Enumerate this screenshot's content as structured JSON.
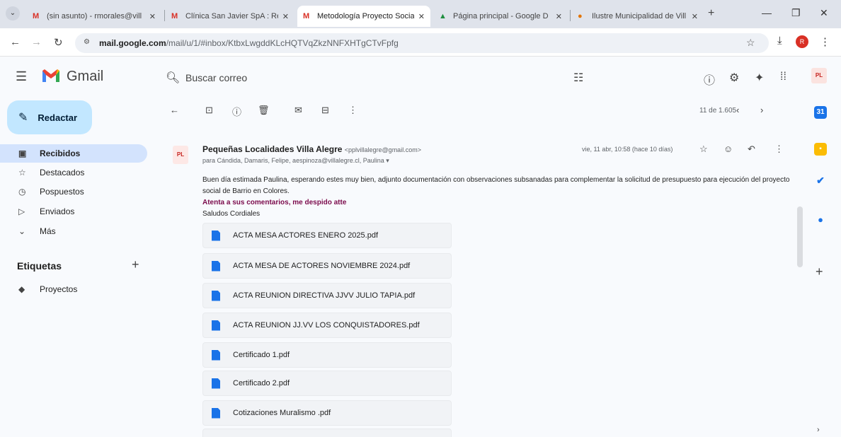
{
  "browser": {
    "tabs": [
      {
        "title": "(sin asunto) - rmorales@vill",
        "favicon": "gmail-icon"
      },
      {
        "title": "Clínica San Javier SpA : Rese",
        "favicon": "gmail-icon"
      },
      {
        "title": "Metodología Proyecto Socia",
        "favicon": "gmail-icon",
        "active": true
      },
      {
        "title": "Página principal - Google D",
        "favicon": "drive-icon"
      },
      {
        "title": "Ilustre Municipalidad de Vill",
        "favicon": "municipal-icon"
      }
    ],
    "url_host": "mail.google.com",
    "url_path": "/mail/u/1/#inbox/KtbxLwgddKLcHQTVqZkzNNFXHTgCTvFpfg",
    "profile_initial": "R"
  },
  "gmail": {
    "app_name": "Gmail",
    "search_placeholder": "Buscar correo",
    "compose_label": "Redactar",
    "nav": [
      {
        "label": "Recibidos",
        "icon": "inbox-icon",
        "active": true
      },
      {
        "label": "Destacados",
        "icon": "star-icon"
      },
      {
        "label": "Pospuestos",
        "icon": "clock-icon"
      },
      {
        "label": "Enviados",
        "icon": "send-icon"
      },
      {
        "label": "Más",
        "icon": "chevron-down-icon"
      }
    ],
    "labels_title": "Etiquetas",
    "labels": [
      {
        "label": "Proyectos",
        "icon": "label-icon"
      }
    ],
    "message_count": "11 de 1.605"
  },
  "message": {
    "sender_name": "Pequeñas Localidades Villa Alegre",
    "sender_email": "<pplvillalegre@gmail.com>",
    "recipients": "para Cándida, Damaris, Felipe, aespinoza@villalegre.cl, Paulina ▾",
    "date": "vie, 11 abr, 10:58 (hace 10 días)",
    "body_line1": "Buen día estimada Paulina, esperando estes muy bien, adjunto documentación con observaciones subsanadas para complementar la solicitud de presupuesto para ejecución del proyecto social de Barrio en Colores.",
    "body_highlight": "Atenta a sus comentarios, me despido atte",
    "body_closing": "Saludos Cordiales",
    "attachments": [
      "ACTA MESA ACTORES ENERO 2025.pdf",
      "ACTA MESA DE ACTORES NOVIEMBRE 2024.pdf",
      "ACTA REUNION DIRECTIVA JJVV JULIO TAPIA.pdf",
      "ACTA REUNION JJ.VV LOS CONQUISTADORES.pdf",
      "Certificado 1.pdf",
      "Certificado 2.pdf",
      "Cotizaciones Muralismo .pdf"
    ]
  },
  "colors": {
    "compose_bg": "#c2e7ff",
    "nav_active_bg": "#d3e3fd",
    "highlight_text": "#7b0b4c",
    "pdf_icon": "#1a73e8"
  }
}
